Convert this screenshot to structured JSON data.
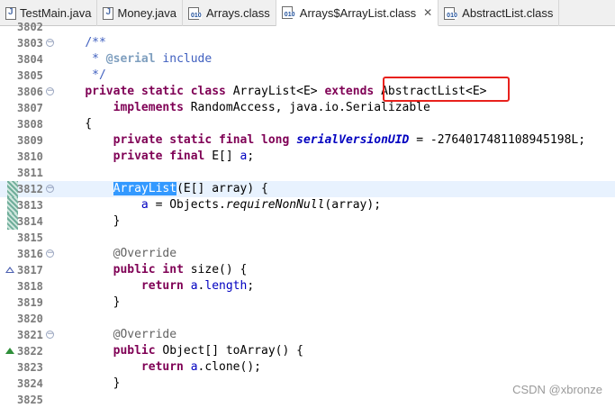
{
  "tabs": [
    {
      "label": "TestMain.java",
      "icon": "java-file-icon",
      "active": false
    },
    {
      "label": "Money.java",
      "icon": "java-file-icon",
      "active": false
    },
    {
      "label": "Arrays.class",
      "icon": "class-file-icon",
      "active": false
    },
    {
      "label": "Arrays$ArrayList.class",
      "icon": "class-file-icon",
      "active": true,
      "close": "✕"
    },
    {
      "label": "AbstractList.class",
      "icon": "class-file-icon",
      "active": false
    }
  ],
  "editor": {
    "lines": [
      {
        "num": "3802",
        "fold": "",
        "marker": "",
        "segments": []
      },
      {
        "num": "3803",
        "fold": "−",
        "marker": "",
        "segments": [
          {
            "t": "    "
          },
          {
            "t": "/**",
            "c": "cm"
          }
        ]
      },
      {
        "num": "3804",
        "fold": "",
        "marker": "",
        "segments": [
          {
            "t": "     "
          },
          {
            "t": "* ",
            "c": "cm"
          },
          {
            "t": "@serial",
            "c": "ctag"
          },
          {
            "t": " include",
            "c": "cm"
          }
        ]
      },
      {
        "num": "3805",
        "fold": "",
        "marker": "",
        "segments": [
          {
            "t": "     "
          },
          {
            "t": "*/",
            "c": "cm"
          }
        ]
      },
      {
        "num": "3806",
        "fold": "−",
        "marker": "",
        "segments": [
          {
            "t": "    "
          },
          {
            "t": "private",
            "c": "kw"
          },
          {
            "t": " "
          },
          {
            "t": "static",
            "c": "kw"
          },
          {
            "t": " "
          },
          {
            "t": "class",
            "c": "kw"
          },
          {
            "t": " ArrayList<E> "
          },
          {
            "t": "extends",
            "c": "kw"
          },
          {
            "t": " AbstractList<E>"
          }
        ]
      },
      {
        "num": "3807",
        "fold": "",
        "marker": "",
        "segments": [
          {
            "t": "        "
          },
          {
            "t": "implements",
            "c": "kw"
          },
          {
            "t": " RandomAccess, java.io.Serializable"
          }
        ]
      },
      {
        "num": "3808",
        "fold": "",
        "marker": "",
        "segments": [
          {
            "t": "    {"
          }
        ]
      },
      {
        "num": "3809",
        "fold": "",
        "marker": "",
        "segments": [
          {
            "t": "        "
          },
          {
            "t": "private",
            "c": "kw"
          },
          {
            "t": " "
          },
          {
            "t": "static",
            "c": "kw"
          },
          {
            "t": " "
          },
          {
            "t": "final",
            "c": "kw"
          },
          {
            "t": " "
          },
          {
            "t": "long",
            "c": "kw"
          },
          {
            "t": " "
          },
          {
            "t": "serialVersionUID",
            "c": "sfld"
          },
          {
            "t": " = -2764017481108945198L;"
          }
        ]
      },
      {
        "num": "3810",
        "fold": "",
        "marker": "",
        "segments": [
          {
            "t": "        "
          },
          {
            "t": "private",
            "c": "kw"
          },
          {
            "t": " "
          },
          {
            "t": "final",
            "c": "kw"
          },
          {
            "t": " E[] "
          },
          {
            "t": "a",
            "c": "fld"
          },
          {
            "t": ";"
          }
        ]
      },
      {
        "num": "3811",
        "fold": "",
        "marker": "",
        "segments": []
      },
      {
        "num": "3812",
        "fold": "−",
        "marker": "change",
        "hl": true,
        "segments": [
          {
            "t": "        "
          },
          {
            "t": "ArrayList",
            "c": "sel"
          },
          {
            "t": "(E[] array) {"
          }
        ]
      },
      {
        "num": "3813",
        "fold": "",
        "marker": "change",
        "segments": [
          {
            "t": "            "
          },
          {
            "t": "a",
            "c": "fld"
          },
          {
            "t": " = Objects."
          },
          {
            "t": "requireNonNull",
            "c": "it"
          },
          {
            "t": "(array);"
          }
        ]
      },
      {
        "num": "3814",
        "fold": "",
        "marker": "change",
        "segments": [
          {
            "t": "        }"
          }
        ]
      },
      {
        "num": "3815",
        "fold": "",
        "marker": "",
        "segments": []
      },
      {
        "num": "3816",
        "fold": "−",
        "marker": "",
        "segments": [
          {
            "t": "        "
          },
          {
            "t": "@Override",
            "c": "ann"
          }
        ]
      },
      {
        "num": "3817",
        "fold": "",
        "marker": "override",
        "segments": [
          {
            "t": "        "
          },
          {
            "t": "public",
            "c": "kw"
          },
          {
            "t": " "
          },
          {
            "t": "int",
            "c": "kw"
          },
          {
            "t": " size() {"
          }
        ]
      },
      {
        "num": "3818",
        "fold": "",
        "marker": "",
        "segments": [
          {
            "t": "            "
          },
          {
            "t": "return",
            "c": "kw"
          },
          {
            "t": " "
          },
          {
            "t": "a",
            "c": "fld"
          },
          {
            "t": "."
          },
          {
            "t": "length",
            "c": "fld"
          },
          {
            "t": ";"
          }
        ]
      },
      {
        "num": "3819",
        "fold": "",
        "marker": "",
        "segments": [
          {
            "t": "        }"
          }
        ]
      },
      {
        "num": "3820",
        "fold": "",
        "marker": "",
        "segments": []
      },
      {
        "num": "3821",
        "fold": "−",
        "marker": "",
        "segments": [
          {
            "t": "        "
          },
          {
            "t": "@Override",
            "c": "ann"
          }
        ]
      },
      {
        "num": "3822",
        "fold": "",
        "marker": "override-green",
        "segments": [
          {
            "t": "        "
          },
          {
            "t": "public",
            "c": "kw"
          },
          {
            "t": " Object[] toArray() {"
          }
        ]
      },
      {
        "num": "3823",
        "fold": "",
        "marker": "",
        "segments": [
          {
            "t": "            "
          },
          {
            "t": "return",
            "c": "kw"
          },
          {
            "t": " "
          },
          {
            "t": "a",
            "c": "fld"
          },
          {
            "t": ".clone();"
          }
        ]
      },
      {
        "num": "3824",
        "fold": "",
        "marker": "",
        "segments": [
          {
            "t": "        }"
          }
        ]
      },
      {
        "num": "3825",
        "fold": "",
        "marker": "",
        "segments": []
      }
    ]
  },
  "watermark": "CSDN @xbronze",
  "colors": {
    "keyword": "#7f0055",
    "comment": "#3f5fbf",
    "field": "#0000c0",
    "selection": "#3399ff",
    "highlight_box": "#e8211c"
  }
}
